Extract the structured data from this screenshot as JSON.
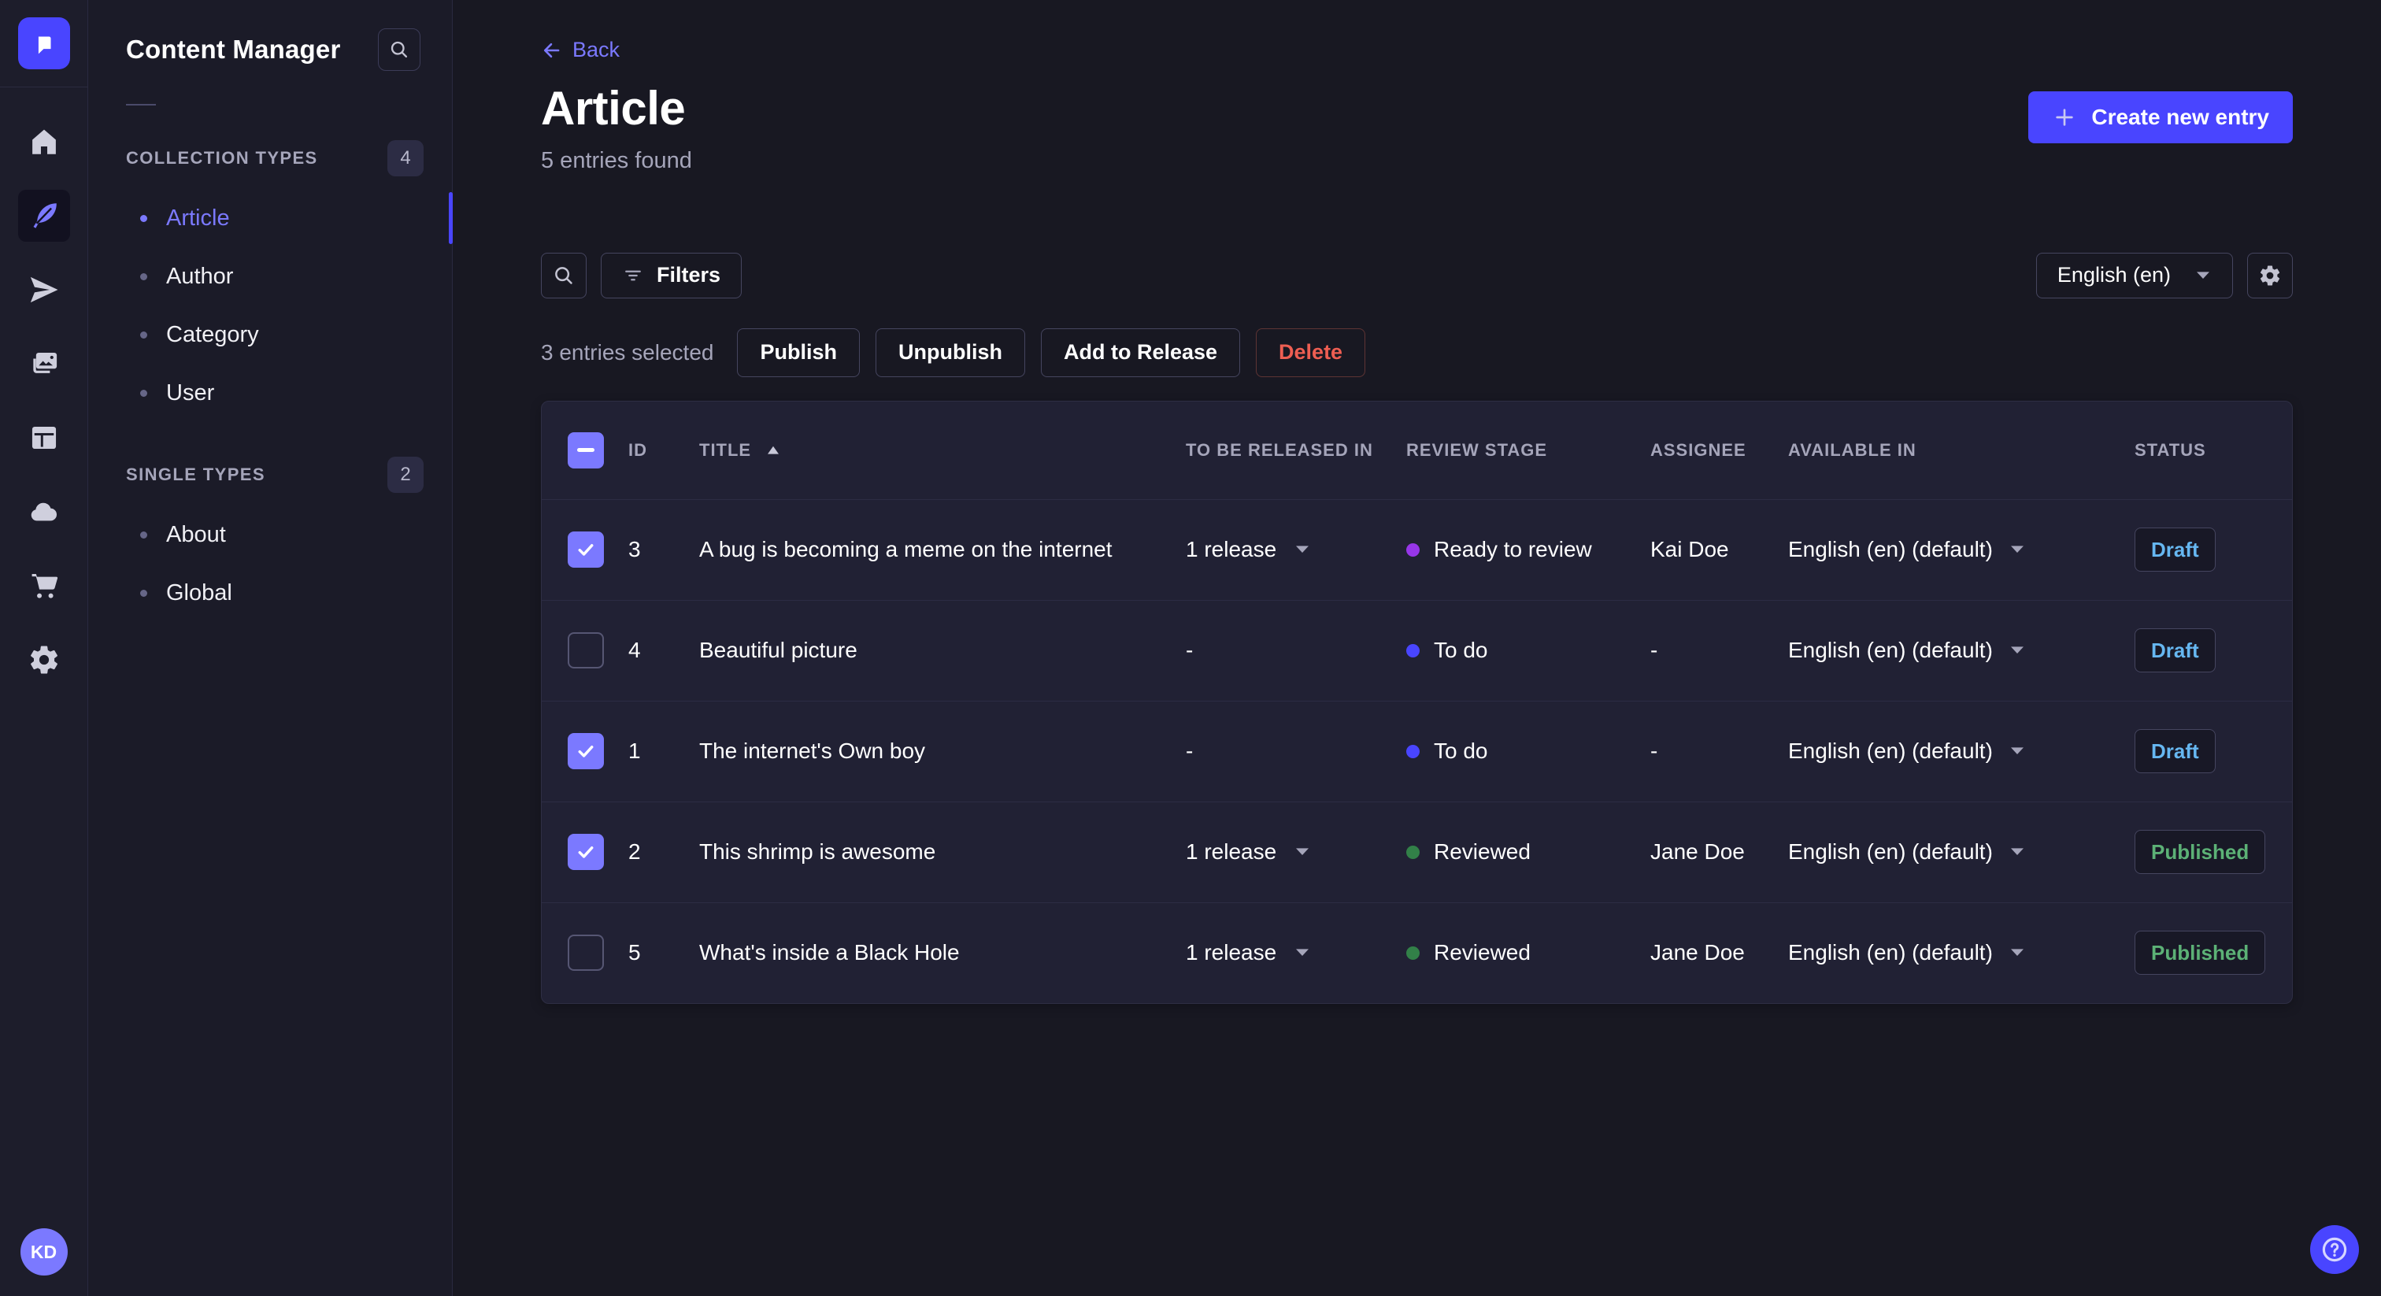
{
  "colors": {
    "primary": "#4945ff",
    "primary_light": "#7b79ff",
    "status_draft": "#66b7f1",
    "status_published": "#5cb176",
    "danger": "#ee5e52"
  },
  "rail": {
    "avatar_initials": "KD",
    "icons": [
      "strapi-logo",
      "home",
      "content-manager",
      "releases",
      "media-library",
      "content-type-builder",
      "cloud",
      "marketplace",
      "settings"
    ]
  },
  "subnav": {
    "title": "Content Manager",
    "sections": [
      {
        "label": "COLLECTION TYPES",
        "badge": "4",
        "items": [
          {
            "label": "Article",
            "active": true
          },
          {
            "label": "Author",
            "active": false
          },
          {
            "label": "Category",
            "active": false
          },
          {
            "label": "User",
            "active": false
          }
        ]
      },
      {
        "label": "SINGLE TYPES",
        "badge": "2",
        "items": [
          {
            "label": "About",
            "active": false
          },
          {
            "label": "Global",
            "active": false
          }
        ]
      }
    ]
  },
  "header": {
    "back_label": "Back",
    "title": "Article",
    "subtitle": "5 entries found",
    "create_button_label": "Create new entry"
  },
  "toolbar": {
    "filters_label": "Filters",
    "locale_value": "English (en)"
  },
  "selection": {
    "text": "3 entries selected",
    "actions": [
      {
        "label": "Publish",
        "variant": "default"
      },
      {
        "label": "Unpublish",
        "variant": "default"
      },
      {
        "label": "Add to Release",
        "variant": "default"
      },
      {
        "label": "Delete",
        "variant": "danger"
      }
    ]
  },
  "table": {
    "columns": [
      "ID",
      "TITLE",
      "TO BE RELEASED IN",
      "REVIEW STAGE",
      "ASSIGNEE",
      "AVAILABLE IN",
      "STATUS"
    ],
    "sort": {
      "column": "TITLE",
      "direction": "asc"
    },
    "status_colors": {
      "Draft": "#66b7f1",
      "Published": "#5cb176"
    },
    "rows": [
      {
        "checked": true,
        "id": "3",
        "title": "A bug is becoming a meme on the internet",
        "released_in": "1 release",
        "review_stage": "Ready to review",
        "review_color": "#9736e8",
        "assignee": "Kai Doe",
        "available_in": "English (en) (default)",
        "status": "Draft"
      },
      {
        "checked": false,
        "id": "4",
        "title": "Beautiful picture",
        "released_in": "-",
        "review_stage": "To do",
        "review_color": "#4945ff",
        "assignee": "-",
        "available_in": "English (en) (default)",
        "status": "Draft"
      },
      {
        "checked": true,
        "id": "1",
        "title": "The internet's Own boy",
        "released_in": "-",
        "review_stage": "To do",
        "review_color": "#4945ff",
        "assignee": "-",
        "available_in": "English (en) (default)",
        "status": "Draft"
      },
      {
        "checked": true,
        "id": "2",
        "title": "This shrimp is awesome",
        "released_in": "1 release",
        "review_stage": "Reviewed",
        "review_color": "#328048",
        "assignee": "Jane Doe",
        "available_in": "English (en) (default)",
        "status": "Published"
      },
      {
        "checked": false,
        "id": "5",
        "title": "What's inside a Black Hole",
        "released_in": "1 release",
        "review_stage": "Reviewed",
        "review_color": "#328048",
        "assignee": "Jane Doe",
        "available_in": "English (en) (default)",
        "status": "Published"
      }
    ]
  }
}
